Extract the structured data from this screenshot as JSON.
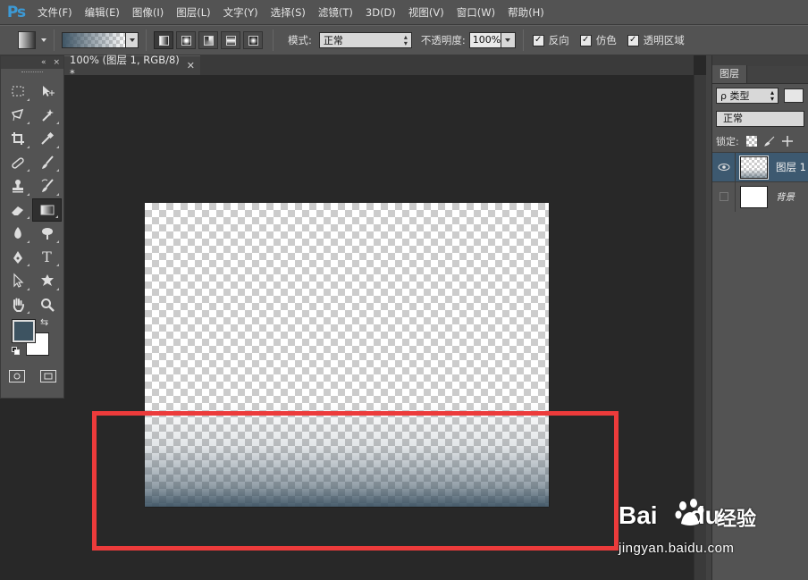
{
  "app": {
    "logo": "Ps"
  },
  "menu": [
    "文件(F)",
    "编辑(E)",
    "图像(I)",
    "图层(L)",
    "文字(Y)",
    "选择(S)",
    "滤镜(T)",
    "3D(D)",
    "视图(V)",
    "窗口(W)",
    "帮助(H)"
  ],
  "options": {
    "mode_label": "模式:",
    "mode_value": "正常",
    "opacity_label": "不透明度:",
    "opacity_value": "100%",
    "reverse_label": "反向",
    "dither_label": "仿色",
    "transparency_label": "透明区域",
    "reverse_checked": true,
    "dither_checked": true,
    "transparency_checked": true,
    "gradient_types": [
      "linear",
      "radial",
      "angle",
      "reflected",
      "diamond"
    ],
    "active_gradient_type": "linear"
  },
  "document": {
    "tab_title": "100% (图层 1, RGB/8) *"
  },
  "tools": {
    "panel_controls": [
      "«",
      "×"
    ],
    "foreground_color": "#3d5361",
    "background_color": "#ffffff",
    "type_tool_glyph": "T"
  },
  "layers_panel": {
    "tab_label": "图层",
    "filter_label": "ρ 类型",
    "blend_mode": "正常",
    "lock_label": "锁定:",
    "layers": [
      {
        "name": "图层 1",
        "visible": true,
        "active": true,
        "thumb": "transparent-gradient"
      },
      {
        "name": "背景",
        "visible": false,
        "active": false,
        "thumb": "white"
      }
    ]
  },
  "highlight_color": "#ec3b3b",
  "watermark": {
    "brand": "Bai",
    "brand2": "du",
    "suffix": "经验",
    "url": "jingyan.baidu.com"
  }
}
